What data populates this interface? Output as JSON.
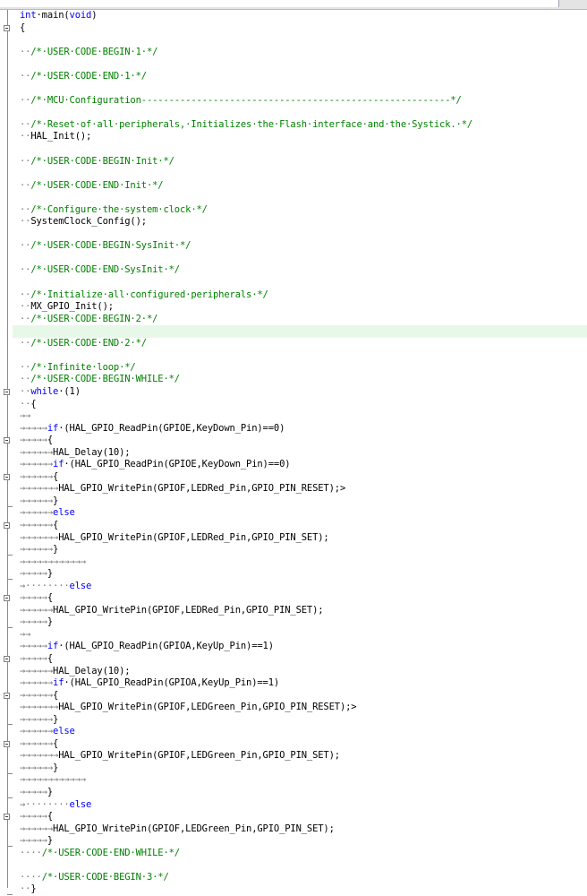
{
  "editor": {
    "lines": [
      {
        "s": [
          {
            "t": "int",
            "c": "kw"
          },
          {
            "t": "·main(",
            "c": "id"
          },
          {
            "t": "void",
            "c": "kw"
          },
          {
            "t": ")",
            "c": "id"
          }
        ]
      },
      {
        "s": [
          {
            "t": "{",
            "c": "id"
          }
        ]
      },
      {
        "s": []
      },
      {
        "s": [
          {
            "t": "··",
            "c": "ws"
          },
          {
            "t": "/*·USER·CODE·BEGIN·1·*/",
            "c": "cm"
          }
        ]
      },
      {
        "s": []
      },
      {
        "s": [
          {
            "t": "··",
            "c": "ws"
          },
          {
            "t": "/*·USER·CODE·END·1·*/",
            "c": "cm"
          }
        ]
      },
      {
        "s": []
      },
      {
        "s": [
          {
            "t": "··",
            "c": "ws"
          },
          {
            "t": "/*·MCU·Configuration--------------------------------------------------------*/",
            "c": "cm"
          }
        ]
      },
      {
        "s": []
      },
      {
        "s": [
          {
            "t": "··",
            "c": "ws"
          },
          {
            "t": "/*·Reset·of·all·peripherals,·Initializes·the·Flash·interface·and·the·Systick.·*/",
            "c": "cm"
          }
        ]
      },
      {
        "s": [
          {
            "t": "··",
            "c": "ws"
          },
          {
            "t": "HAL_Init();",
            "c": "id"
          }
        ]
      },
      {
        "s": []
      },
      {
        "s": [
          {
            "t": "··",
            "c": "ws"
          },
          {
            "t": "/*·USER·CODE·BEGIN·Init·*/",
            "c": "cm"
          }
        ]
      },
      {
        "s": []
      },
      {
        "s": [
          {
            "t": "··",
            "c": "ws"
          },
          {
            "t": "/*·USER·CODE·END·Init·*/",
            "c": "cm"
          }
        ]
      },
      {
        "s": []
      },
      {
        "s": [
          {
            "t": "··",
            "c": "ws"
          },
          {
            "t": "/*·Configure·the·system·clock·*/",
            "c": "cm"
          }
        ]
      },
      {
        "s": [
          {
            "t": "··",
            "c": "ws"
          },
          {
            "t": "SystemClock_Config();",
            "c": "id"
          }
        ]
      },
      {
        "s": []
      },
      {
        "s": [
          {
            "t": "··",
            "c": "ws"
          },
          {
            "t": "/*·USER·CODE·BEGIN·SysInit·*/",
            "c": "cm"
          }
        ]
      },
      {
        "s": []
      },
      {
        "s": [
          {
            "t": "··",
            "c": "ws"
          },
          {
            "t": "/*·USER·CODE·END·SysInit·*/",
            "c": "cm"
          }
        ]
      },
      {
        "s": []
      },
      {
        "s": [
          {
            "t": "··",
            "c": "ws"
          },
          {
            "t": "/*·Initialize·all·configured·peripherals·*/",
            "c": "cm"
          }
        ]
      },
      {
        "s": [
          {
            "t": "··",
            "c": "ws"
          },
          {
            "t": "MX_GPIO_Init();",
            "c": "id"
          }
        ]
      },
      {
        "s": [
          {
            "t": "··",
            "c": "ws"
          },
          {
            "t": "/*·USER·CODE·BEGIN·2·*/",
            "c": "cm"
          }
        ]
      },
      {
        "s": [],
        "hl": true
      },
      {
        "s": [
          {
            "t": "··",
            "c": "ws"
          },
          {
            "t": "/*·USER·CODE·END·2·*/",
            "c": "cm"
          }
        ]
      },
      {
        "s": []
      },
      {
        "s": [
          {
            "t": "··",
            "c": "ws"
          },
          {
            "t": "/*·Infinite·loop·*/",
            "c": "cm"
          }
        ]
      },
      {
        "s": [
          {
            "t": "··",
            "c": "ws"
          },
          {
            "t": "/*·USER·CODE·BEGIN·WHILE·*/",
            "c": "cm"
          }
        ]
      },
      {
        "s": [
          {
            "t": "··",
            "c": "ws"
          },
          {
            "t": "while",
            "c": "kw"
          },
          {
            "t": "·(1)",
            "c": "id"
          }
        ]
      },
      {
        "s": [
          {
            "t": "··",
            "c": "ws"
          },
          {
            "t": "{",
            "c": "id"
          }
        ]
      },
      {
        "s": [
          {
            "t": "→→",
            "c": "ws"
          }
        ]
      },
      {
        "s": [
          {
            "t": "→→→→→",
            "c": "ws"
          },
          {
            "t": "if",
            "c": "kw"
          },
          {
            "t": "·(HAL_GPIO_ReadPin(GPIOE,KeyDown_Pin)==0)",
            "c": "id"
          }
        ]
      },
      {
        "s": [
          {
            "t": "→→→→→",
            "c": "ws"
          },
          {
            "t": "{",
            "c": "id"
          }
        ]
      },
      {
        "s": [
          {
            "t": "→→→→→→",
            "c": "ws"
          },
          {
            "t": "HAL_Delay(10);",
            "c": "id"
          }
        ]
      },
      {
        "s": [
          {
            "t": "→→→→→→",
            "c": "ws"
          },
          {
            "t": "if",
            "c": "kw"
          },
          {
            "t": "·(HAL_GPIO_ReadPin(GPIOE,KeyDown_Pin)==0)",
            "c": "id"
          }
        ]
      },
      {
        "s": [
          {
            "t": "→→→→→→",
            "c": "ws"
          },
          {
            "t": "{",
            "c": "id"
          }
        ]
      },
      {
        "s": [
          {
            "t": "→→→→→→→",
            "c": "ws"
          },
          {
            "t": "HAL_GPIO_WritePin(GPIOF,LEDRed_Pin,GPIO_PIN_RESET);>",
            "c": "id"
          }
        ]
      },
      {
        "s": [
          {
            "t": "→→→→→→",
            "c": "ws"
          },
          {
            "t": "}",
            "c": "id"
          }
        ]
      },
      {
        "s": [
          {
            "t": "→→→→→→",
            "c": "ws"
          },
          {
            "t": "else",
            "c": "kw"
          }
        ]
      },
      {
        "s": [
          {
            "t": "→→→→→→",
            "c": "ws"
          },
          {
            "t": "{",
            "c": "id"
          }
        ]
      },
      {
        "s": [
          {
            "t": "→→→→→→→",
            "c": "ws"
          },
          {
            "t": "HAL_GPIO_WritePin(GPIOF,LEDRed_Pin,GPIO_PIN_SET);",
            "c": "id"
          }
        ]
      },
      {
        "s": [
          {
            "t": "→→→→→→",
            "c": "ws"
          },
          {
            "t": "}",
            "c": "id"
          }
        ]
      },
      {
        "s": [
          {
            "t": "→→→→→→→→→→→→",
            "c": "ws"
          }
        ]
      },
      {
        "s": [
          {
            "t": "→→→→→",
            "c": "ws"
          },
          {
            "t": "}",
            "c": "id"
          }
        ]
      },
      {
        "s": [
          {
            "t": "→········",
            "c": "ws"
          },
          {
            "t": "else",
            "c": "kw"
          }
        ]
      },
      {
        "s": [
          {
            "t": "→→→→→",
            "c": "ws"
          },
          {
            "t": "{",
            "c": "id"
          }
        ]
      },
      {
        "s": [
          {
            "t": "→→→→→→",
            "c": "ws"
          },
          {
            "t": "HAL_GPIO_WritePin(GPIOF,LEDRed_Pin,GPIO_PIN_SET);",
            "c": "id"
          }
        ]
      },
      {
        "s": [
          {
            "t": "→→→→→",
            "c": "ws"
          },
          {
            "t": "}",
            "c": "id"
          }
        ]
      },
      {
        "s": [
          {
            "t": "→→",
            "c": "ws"
          }
        ]
      },
      {
        "s": [
          {
            "t": "→→→→→",
            "c": "ws"
          },
          {
            "t": "if",
            "c": "kw"
          },
          {
            "t": "·(HAL_GPIO_ReadPin(GPIOA,KeyUp_Pin)==1)",
            "c": "id"
          }
        ]
      },
      {
        "s": [
          {
            "t": "→→→→→",
            "c": "ws"
          },
          {
            "t": "{",
            "c": "id"
          }
        ]
      },
      {
        "s": [
          {
            "t": "→→→→→→",
            "c": "ws"
          },
          {
            "t": "HAL_Delay(10);",
            "c": "id"
          }
        ]
      },
      {
        "s": [
          {
            "t": "→→→→→→",
            "c": "ws"
          },
          {
            "t": "if",
            "c": "kw"
          },
          {
            "t": "·(HAL_GPIO_ReadPin(GPIOA,KeyUp_Pin)==1)",
            "c": "id"
          }
        ]
      },
      {
        "s": [
          {
            "t": "→→→→→→",
            "c": "ws"
          },
          {
            "t": "{",
            "c": "id"
          }
        ]
      },
      {
        "s": [
          {
            "t": "→→→→→→→",
            "c": "ws"
          },
          {
            "t": "HAL_GPIO_WritePin(GPIOF,LEDGreen_Pin,GPIO_PIN_RESET);>",
            "c": "id"
          }
        ]
      },
      {
        "s": [
          {
            "t": "→→→→→→",
            "c": "ws"
          },
          {
            "t": "}",
            "c": "id"
          }
        ]
      },
      {
        "s": [
          {
            "t": "→→→→→→",
            "c": "ws"
          },
          {
            "t": "else",
            "c": "kw"
          }
        ]
      },
      {
        "s": [
          {
            "t": "→→→→→→",
            "c": "ws"
          },
          {
            "t": "{",
            "c": "id"
          }
        ]
      },
      {
        "s": [
          {
            "t": "→→→→→→→",
            "c": "ws"
          },
          {
            "t": "HAL_GPIO_WritePin(GPIOF,LEDGreen_Pin,GPIO_PIN_SET);",
            "c": "id"
          }
        ]
      },
      {
        "s": [
          {
            "t": "→→→→→→",
            "c": "ws"
          },
          {
            "t": "}",
            "c": "id"
          }
        ]
      },
      {
        "s": [
          {
            "t": "→→→→→→→→→→→→",
            "c": "ws"
          }
        ]
      },
      {
        "s": [
          {
            "t": "→→→→→",
            "c": "ws"
          },
          {
            "t": "}",
            "c": "id"
          }
        ]
      },
      {
        "s": [
          {
            "t": "→········",
            "c": "ws"
          },
          {
            "t": "else",
            "c": "kw"
          }
        ]
      },
      {
        "s": [
          {
            "t": "→→→→→",
            "c": "ws"
          },
          {
            "t": "{",
            "c": "id"
          }
        ]
      },
      {
        "s": [
          {
            "t": "→→→→→→",
            "c": "ws"
          },
          {
            "t": "HAL_GPIO_WritePin(GPIOF,LEDGreen_Pin,GPIO_PIN_SET);",
            "c": "id"
          }
        ]
      },
      {
        "s": [
          {
            "t": "→→→→→",
            "c": "ws"
          },
          {
            "t": "}",
            "c": "id"
          }
        ]
      },
      {
        "s": [
          {
            "t": "····",
            "c": "ws"
          },
          {
            "t": "/*·USER·CODE·END·WHILE·*/",
            "c": "cm"
          }
        ]
      },
      {
        "s": []
      },
      {
        "s": [
          {
            "t": "····",
            "c": "ws"
          },
          {
            "t": "/*·USER·CODE·BEGIN·3·*/",
            "c": "cm"
          }
        ]
      },
      {
        "s": [
          {
            "t": "··",
            "c": "ws"
          },
          {
            "t": "}",
            "c": "id"
          }
        ]
      }
    ],
    "fold_markers": [
      1,
      31,
      35,
      38,
      42,
      48,
      53,
      56,
      60,
      66
    ]
  },
  "colors": {
    "keyword": "#0000ff",
    "comment": "#008000",
    "whitespace_marker": "#7a7a7a",
    "current_line": "#e8f8e8"
  }
}
